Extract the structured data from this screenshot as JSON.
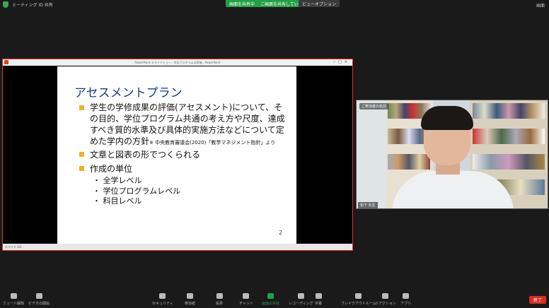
{
  "topbar": {
    "meeting_label": "ミーティング ID 共有",
    "share_banner": "画面を共有中",
    "share_banner_note": "ご画面を共有しています",
    "view_option": "ビューオプション",
    "top_right": "画面"
  },
  "ppt": {
    "titlebar": "PowerPoint スライドショー - 学位プログラムの評価 - PowerPoint",
    "statusbar": "スライド 2/2"
  },
  "slide": {
    "title": "アセスメントプラン",
    "bullet1": "学生の学修成果の評価(アセスメント)について、その目的、学位プログラム共通の考え方や尺度、達成すべき質的水準及び具体的実施方法などについて定めた学内の方針",
    "bullet1_note": "※ 中央教育審議会(2020)「教学マネジメント指針」より",
    "bullet2": "文章と図表の形でつくられる",
    "bullet3": "作成の単位",
    "sub1": "・ 全学レベル",
    "sub2": "・ 学位プログラムレベル",
    "sub3": "・ 科目レベル",
    "page": "2"
  },
  "video": {
    "label": "ご参加者の名前",
    "name": "松下 先生"
  },
  "toolbar": {
    "items": [
      "ミュート解除",
      "ビデオの開始",
      "セキュリティ",
      "参加者",
      "投票",
      "チャット",
      "画面の共有",
      "レコーディング",
      "字幕",
      "ブレイクアウトルーム",
      "リアクション",
      "アプリ"
    ],
    "participants_count": "27",
    "end": "終了"
  }
}
